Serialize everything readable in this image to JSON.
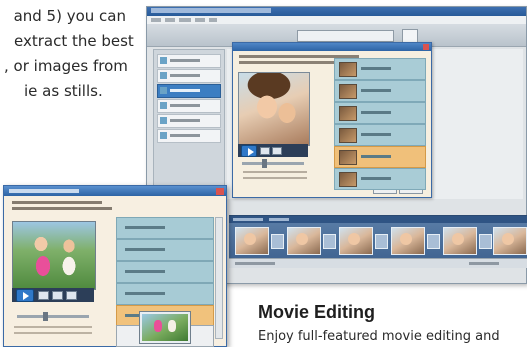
{
  "intro": {
    "lines": [
      "and 5) you can",
      "extract the best",
      ", or images from",
      "ie as stills."
    ]
  },
  "section": {
    "title": "Movie Editing",
    "subtitle": "Enjoy full-featured movie editing and"
  },
  "colors": {
    "window_title_blue": "#2d64a5",
    "list_teal": "#a9ccd6",
    "selected_orange": "#f0c07a",
    "dialog_cream": "#f6efe0"
  }
}
